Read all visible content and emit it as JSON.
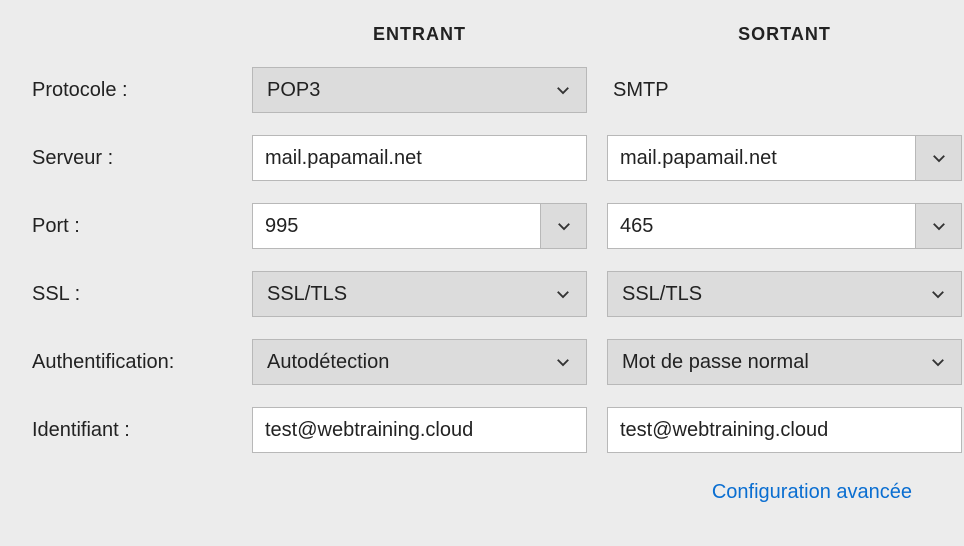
{
  "headers": {
    "incoming": "ENTRANT",
    "outgoing": "SORTANT"
  },
  "labels": {
    "protocol": "Protocole :",
    "server": "Serveur :",
    "port": "Port :",
    "ssl": "SSL :",
    "auth": "Authentification:",
    "username": "Identifiant :"
  },
  "incoming": {
    "protocol": "POP3",
    "server": "mail.papamail.net",
    "port": "995",
    "ssl": "SSL/TLS",
    "auth": "Autodétection",
    "username": "test@webtraining.cloud"
  },
  "outgoing": {
    "protocol": "SMTP",
    "server": "mail.papamail.net",
    "port": "465",
    "ssl": "SSL/TLS",
    "auth": "Mot de passe normal",
    "username": "test@webtraining.cloud"
  },
  "footer": {
    "advanced": "Configuration avancée"
  }
}
